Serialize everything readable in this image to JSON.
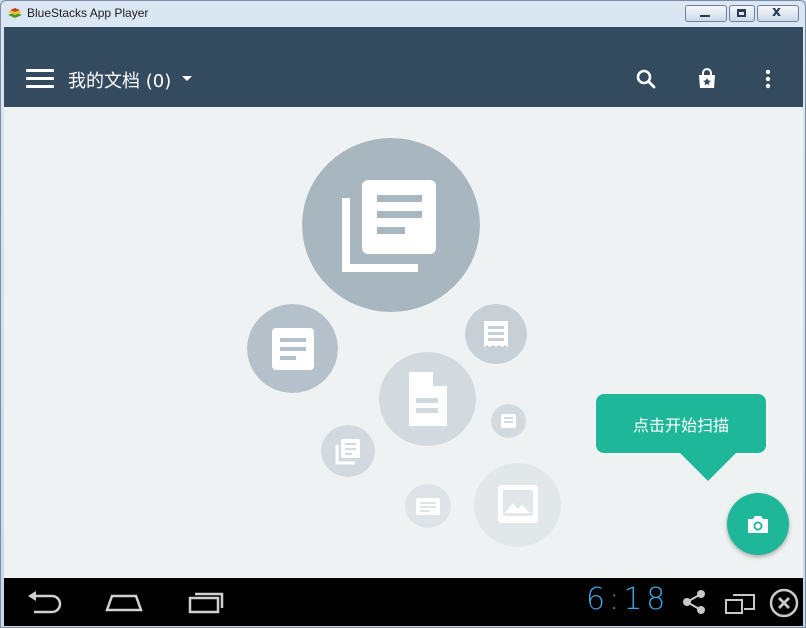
{
  "window": {
    "title": "BlueStacks App Player",
    "controls": [
      "minimize-icon",
      "maximize-icon",
      "close-icon"
    ]
  },
  "appbar": {
    "menu_icon": "hamburger-menu-icon",
    "title": "我的文档 (0)",
    "dropdown_icon": "caret-down-icon",
    "actions": [
      "search-icon",
      "shopping-bag-icon",
      "more-vert-icon"
    ],
    "background": "#344a5e"
  },
  "empty_state": {
    "icons": [
      "documents-stack-icon",
      "note-icon",
      "receipt-icon",
      "file-icon",
      "small-note-icon",
      "documents-icon",
      "card-icon",
      "image-icon"
    ]
  },
  "scan": {
    "tooltip_text": "点击开始扫描",
    "fab_icon": "camera-icon",
    "accent": "#1fb79a"
  },
  "navbar": {
    "buttons": [
      "back-icon",
      "home-icon",
      "recent-apps-icon"
    ],
    "clock": "6:18",
    "tray": [
      "share-icon",
      "multi-window-icon",
      "close-circle-icon"
    ]
  }
}
